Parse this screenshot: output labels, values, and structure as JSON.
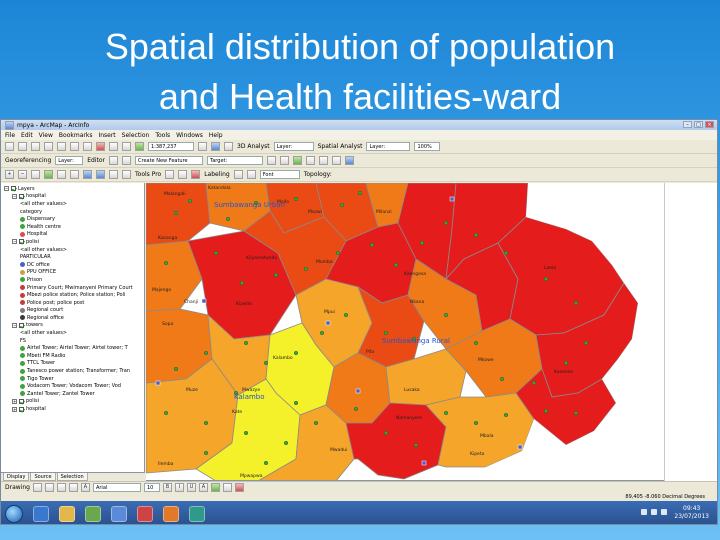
{
  "slide": {
    "title_line1": "Spatial distribution of population",
    "title_line2": "and Health facilities-ward"
  },
  "app": {
    "window_title": "mpya - ArcMap - ArcInfo",
    "menus": [
      "File",
      "Edit",
      "View",
      "Bookmarks",
      "Insert",
      "Selection",
      "Tools",
      "Windows",
      "Help"
    ]
  },
  "toolbars": {
    "georeferencing": "Georeferencing",
    "layer_dropdown": "Layer:",
    "editor": "Editor",
    "create_features": "Create New Feature",
    "target": "Target:",
    "spatial_analyst": "Spatial Analyst",
    "spatial_layer": "Layer:",
    "scale": "1:387,237",
    "three_d_analyst": "3D Analyst",
    "three_d_layer": "Layer:",
    "tools_pro": "Tools Pro",
    "labeling": "Labeling",
    "font": "Font",
    "zoom": "100%",
    "topology": "Topology:"
  },
  "toc": {
    "title": "Layers",
    "rows": [
      {
        "indent": 0,
        "expander": "−",
        "checkbox": true,
        "symbol": "",
        "color": "",
        "label": "Layers"
      },
      {
        "indent": 1,
        "expander": "−",
        "checkbox": true,
        "symbol": "",
        "color": "",
        "label": "hospital"
      },
      {
        "indent": 2,
        "expander": "",
        "checkbox": false,
        "symbol": "",
        "color": "",
        "label": "<all other values>"
      },
      {
        "indent": 2,
        "expander": "",
        "checkbox": false,
        "symbol": "",
        "color": "",
        "label": "category"
      },
      {
        "indent": 2,
        "expander": "",
        "checkbox": false,
        "symbol": "dot",
        "color": "#3da33d",
        "label": "Dispensary"
      },
      {
        "indent": 2,
        "expander": "",
        "checkbox": false,
        "symbol": "dot",
        "color": "#3da33d",
        "label": "Health centre"
      },
      {
        "indent": 2,
        "expander": "",
        "checkbox": false,
        "symbol": "dot",
        "color": "#e04a4a",
        "label": "Hospital"
      },
      {
        "indent": 1,
        "expander": "−",
        "checkbox": true,
        "symbol": "",
        "color": "",
        "label": "polisi"
      },
      {
        "indent": 2,
        "expander": "",
        "checkbox": false,
        "symbol": "",
        "color": "",
        "label": "<all other values>"
      },
      {
        "indent": 2,
        "expander": "",
        "checkbox": false,
        "symbol": "",
        "color": "",
        "label": "PARTICULAR"
      },
      {
        "indent": 2,
        "expander": "",
        "checkbox": false,
        "symbol": "dot",
        "color": "#4a5fc9",
        "label": "DC office"
      },
      {
        "indent": 2,
        "expander": "",
        "checkbox": false,
        "symbol": "dot",
        "color": "#c9a23a",
        "label": "PPU OFFICE"
      },
      {
        "indent": 2,
        "expander": "",
        "checkbox": false,
        "symbol": "dot",
        "color": "#3da33d",
        "label": "Prison"
      },
      {
        "indent": 2,
        "expander": "",
        "checkbox": false,
        "symbol": "dot",
        "color": "#c93a3a",
        "label": "Primary Court; Mwimanyeni Primary Court"
      },
      {
        "indent": 2,
        "expander": "",
        "checkbox": false,
        "symbol": "dot",
        "color": "#c93a3a",
        "label": "Mbezi police station; Police station; Poli"
      },
      {
        "indent": 2,
        "expander": "",
        "checkbox": false,
        "symbol": "dot",
        "color": "#c93a3a",
        "label": "Police post; police post"
      },
      {
        "indent": 2,
        "expander": "",
        "checkbox": false,
        "symbol": "dot",
        "color": "#7a7a7a",
        "label": "Regional court"
      },
      {
        "indent": 2,
        "expander": "",
        "checkbox": false,
        "symbol": "dot",
        "color": "#3a3a3a",
        "label": "Regional office"
      },
      {
        "indent": 1,
        "expander": "−",
        "checkbox": true,
        "symbol": "",
        "color": "",
        "label": "towers"
      },
      {
        "indent": 2,
        "expander": "",
        "checkbox": false,
        "symbol": "",
        "color": "",
        "label": "<all other values>"
      },
      {
        "indent": 2,
        "expander": "",
        "checkbox": false,
        "symbol": "",
        "color": "",
        "label": "FS"
      },
      {
        "indent": 2,
        "expander": "",
        "checkbox": false,
        "symbol": "dot",
        "color": "#3da33d",
        "label": "Airtel Tower; Airtel Tower; Airtel tower; T"
      },
      {
        "indent": 2,
        "expander": "",
        "checkbox": false,
        "symbol": "dot",
        "color": "#3da33d",
        "label": "Mbeti FM Radio"
      },
      {
        "indent": 2,
        "expander": "",
        "checkbox": false,
        "symbol": "dot",
        "color": "#3da33d",
        "label": "TTCL Tower"
      },
      {
        "indent": 2,
        "expander": "",
        "checkbox": false,
        "symbol": "dot",
        "color": "#3da33d",
        "label": "Tanesco power station; Transformer; Tran"
      },
      {
        "indent": 2,
        "expander": "",
        "checkbox": false,
        "symbol": "dot",
        "color": "#3da33d",
        "label": "Tigo Tower"
      },
      {
        "indent": 2,
        "expander": "",
        "checkbox": false,
        "symbol": "dot",
        "color": "#3da33d",
        "label": "Vodacom Tower; Vodacom Tower; Vod"
      },
      {
        "indent": 2,
        "expander": "",
        "checkbox": false,
        "symbol": "dot",
        "color": "#3da33d",
        "label": "Zantel Tower; Zantel Tower"
      },
      {
        "indent": 1,
        "expander": "+",
        "checkbox": true,
        "symbol": "",
        "color": "",
        "label": "polisi"
      },
      {
        "indent": 1,
        "expander": "+",
        "checkbox": true,
        "symbol": "",
        "color": "",
        "label": "hospital"
      }
    ],
    "tabs": [
      "Display",
      "Source",
      "Selection"
    ]
  },
  "map": {
    "place_labels": [
      "Sumbawanga Urban",
      "Sumbawanga Rural",
      "Katandala",
      "Kizwite",
      "Malangali",
      "Mazwi",
      "Majengo",
      "Chanji",
      "Matanga",
      "Kasanga",
      "Mollo",
      "Milanzi",
      "Sopa",
      "Momba",
      "Mpui",
      "Kaengesa",
      "Laela",
      "Pito",
      "Kalambo",
      "Mwazye",
      "Muze",
      "Kate",
      "Lusaka",
      "Mkowe",
      "Ilemba",
      "Mpwapwa",
      "Mwadui",
      "Kipeta",
      "Namanyere",
      "Kasense",
      "Mbala",
      "Nkana",
      "Kilyamatundu"
    ],
    "colors": {
      "red": "#e51c1c",
      "orange_red": "#ea4b14",
      "orange": "#f07a17",
      "amber": "#f5a52a",
      "yellow": "#f4f02a",
      "border": "#8a8a8a"
    }
  },
  "drawing": {
    "label": "Drawing",
    "font": "Arial",
    "font_size": "10"
  },
  "status": {
    "coords": "89,405  -8.060 Decimal Degrees"
  },
  "taskbar": {
    "time": "09:43",
    "date": "23/07/2013"
  }
}
